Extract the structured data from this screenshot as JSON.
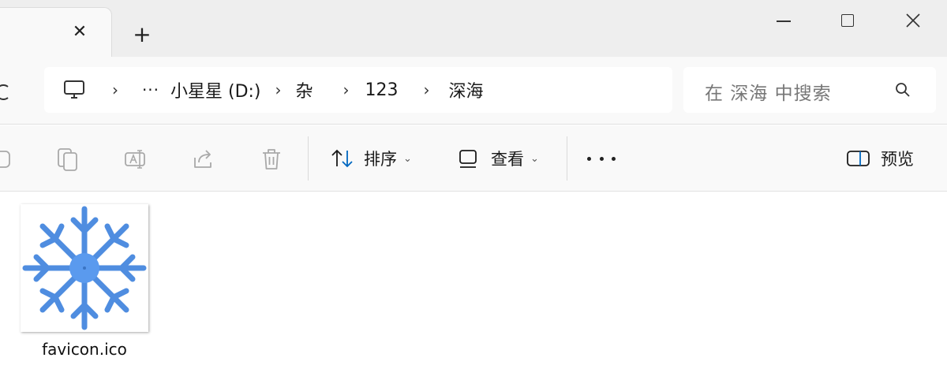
{
  "window": {
    "tab_close_glyph": "✕",
    "new_tab_glyph": "+",
    "controls": {
      "close_glyph": "✕"
    }
  },
  "address_bar": {
    "more_glyph": "···",
    "separator": "›",
    "crumbs": [
      "小星星 (D:)",
      "杂",
      "123",
      "深海"
    ]
  },
  "search": {
    "placeholder": "在 深海 中搜索"
  },
  "toolbar": {
    "sort_label": "排序",
    "view_label": "查看",
    "preview_label": "预览",
    "chevron": "⌄"
  },
  "files": [
    {
      "name": "favicon.ico",
      "icon": "snowflake-icon"
    }
  ],
  "colors": {
    "accent": "#0067c0",
    "snowflake": "#4f8de0",
    "snowflake_center": "#5a9aee",
    "disabled_icon": "#a9a9a9"
  }
}
